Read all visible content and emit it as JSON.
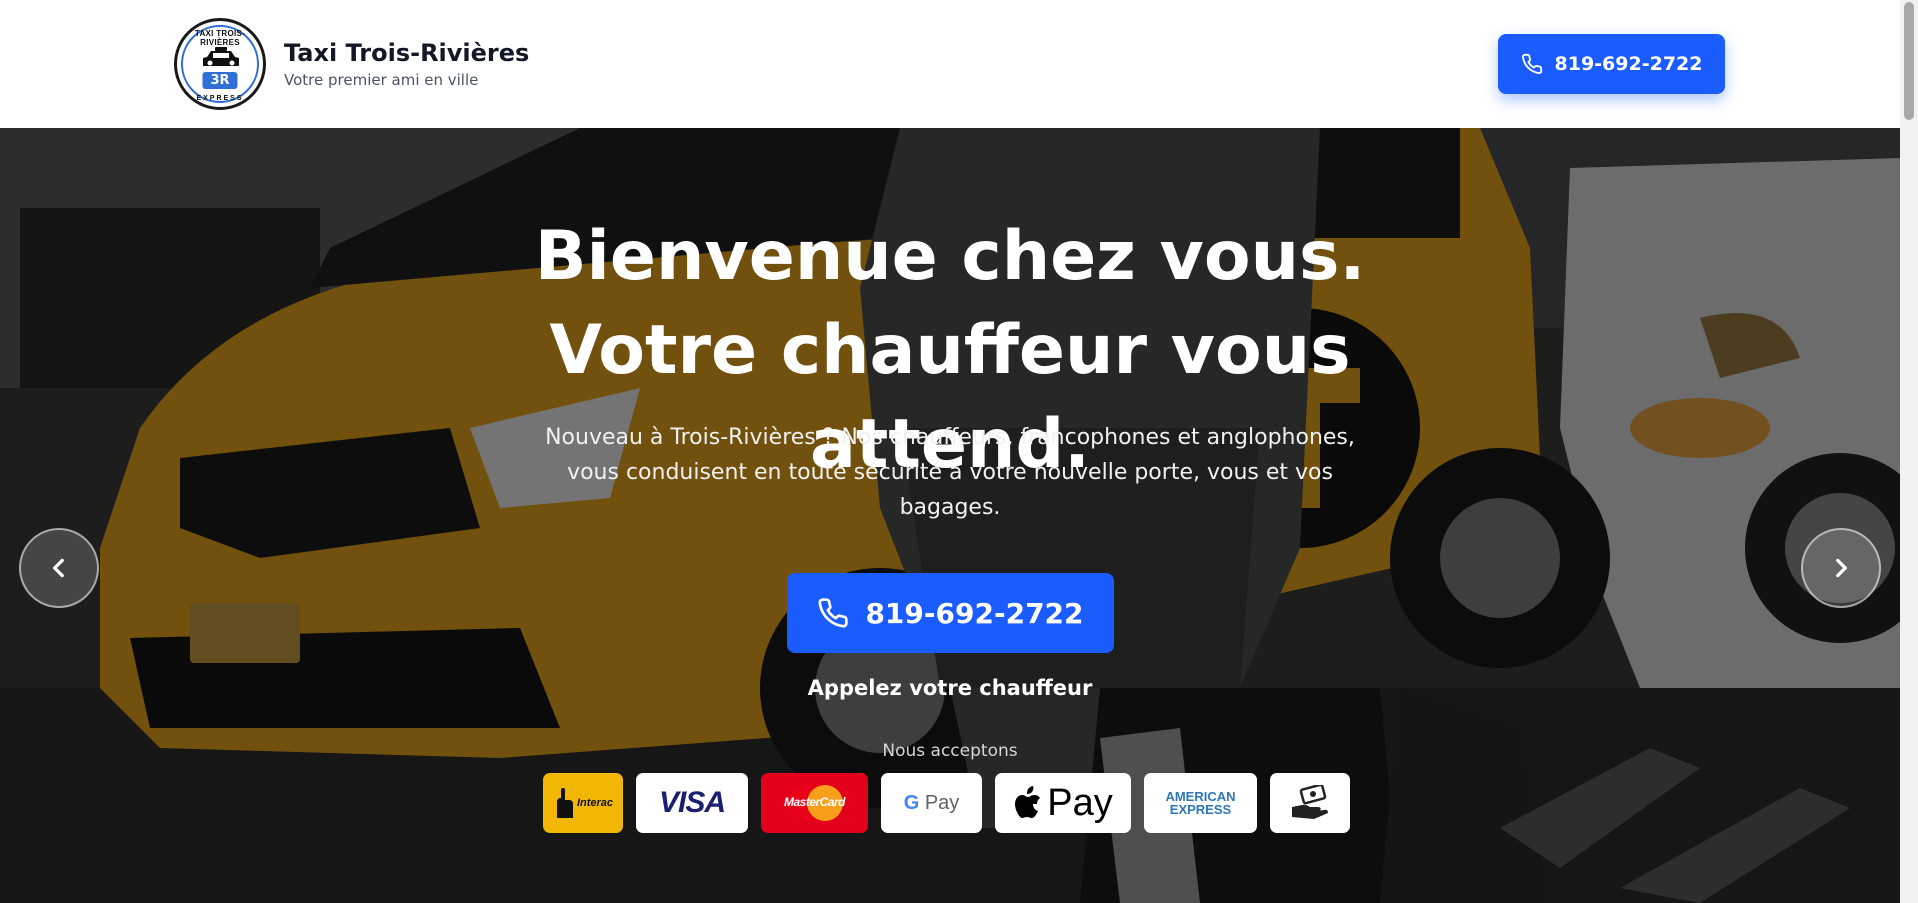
{
  "header": {
    "logo": {
      "top_text": "TAXI TROIS-RIVIÈRES",
      "badge": "3R",
      "bottom_text": "EXPRESS"
    },
    "brand_title": "Taxi Trois-Rivières",
    "brand_subtitle": "Votre premier ami en ville",
    "phone_label": "819-692-2722",
    "phone_icon": "phone-icon"
  },
  "hero": {
    "title": "Bienvenue chez vous. Votre chauffeur vous attend.",
    "description": "Nouveau à Trois-Rivières ? Nos chauffeurs, francophones et anglophones, vous conduisent en toute sécurité à votre nouvelle porte, vous et vos bagages.",
    "phone_label": "819-692-2722",
    "cta_text": "Appelez votre chauffeur",
    "accept_label": "Nous acceptons",
    "prev_icon": "chevron-left-icon",
    "next_icon": "chevron-right-icon"
  },
  "payments": {
    "interac": "Interac",
    "visa": "VISA",
    "mastercard": "MasterCard",
    "gpay": "Pay",
    "gpay_g": "G",
    "applepay": "Pay",
    "amex_line1": "AMERICAN",
    "amex_line2": "EXPRESS",
    "cash_icon": "cash-hand-icon"
  },
  "colors": {
    "primary": "#1b5cff",
    "interac": "#f2b705",
    "mastercard_bg": "#e2001a",
    "visa": "#1a1f71",
    "amex": "#2e77bc",
    "taxi_yellow": "#e3a21a"
  }
}
